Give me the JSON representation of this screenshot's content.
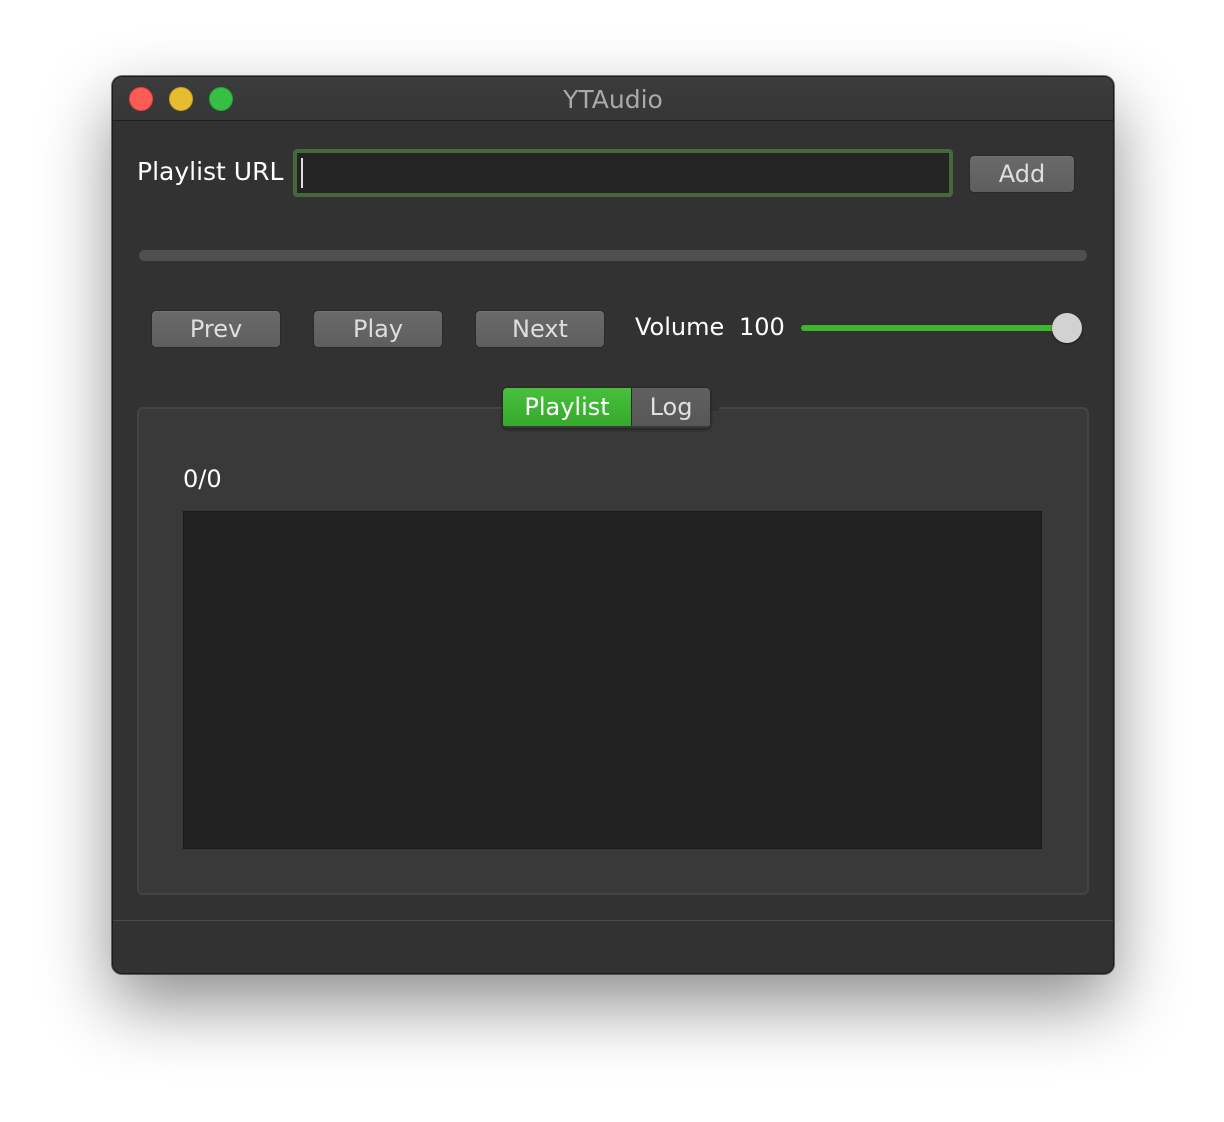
{
  "window": {
    "title": "YTAudio"
  },
  "url_row": {
    "label": "Playlist URL",
    "input_value": "",
    "add_label": "Add"
  },
  "progress": {
    "value": 0
  },
  "controls": {
    "prev_label": "Prev",
    "play_label": "Play",
    "next_label": "Next",
    "volume_label": "Volume",
    "volume_value": "100",
    "volume_level": 1.0
  },
  "tabs": {
    "items": [
      {
        "label": "Playlist",
        "active": true
      },
      {
        "label": "Log",
        "active": false
      }
    ]
  },
  "playlist": {
    "counter": "0/0",
    "items": []
  },
  "colors": {
    "accent": "#3fb62f",
    "window_bg": "#323232",
    "list_bg": "#212121"
  }
}
